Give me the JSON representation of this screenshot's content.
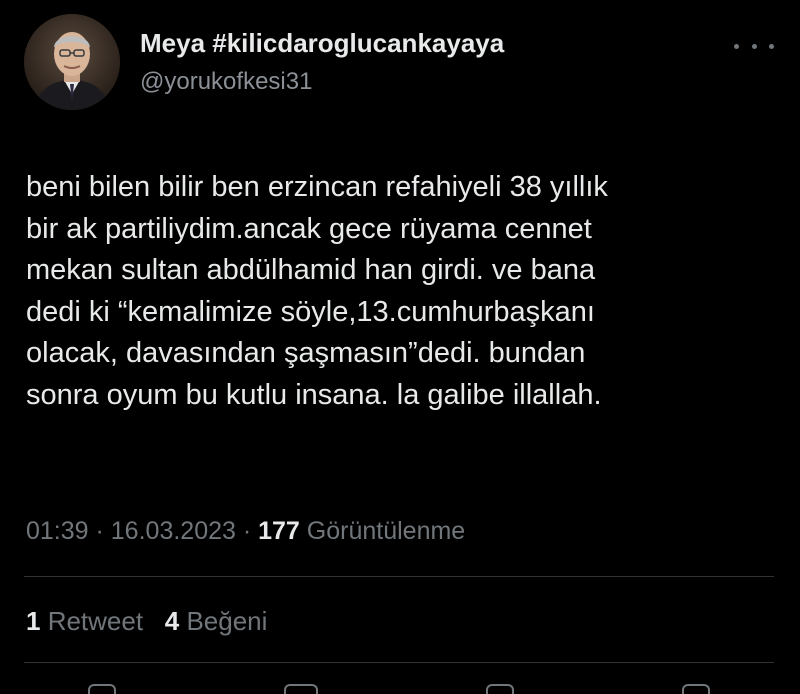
{
  "author": {
    "display_name": "Meya #kilicdaroglucankayaya",
    "handle": "@yorukofkesi31"
  },
  "icons": {
    "avatar": "profile-photo",
    "more": "more-horizontal-icon"
  },
  "tweet": {
    "text": "beni bilen bilir ben erzincan refahiyeli 38 yıllık\nbir ak partiliydim.ancak gece rüyama cennet\nmekan sultan abdülhamid han girdi. ve bana\ndedi ki “kemalimize söyle,13.cumhurbaşkanı\nolacak, davasından şaşmasın”dedi. bundan\nsonra oyum bu kutlu insana. la galibe illallah."
  },
  "meta": {
    "time": "01:39",
    "separator": " · ",
    "date": "16.03.2023",
    "views_count": "177",
    "views_label": " Görüntülenme"
  },
  "stats": {
    "retweets_count": "1",
    "retweets_label": " Retweet",
    "likes_count": "4",
    "likes_label": " Beğeni"
  },
  "colors": {
    "background": "#000000",
    "primary_text": "#e7e9ea",
    "secondary_text": "#71767b",
    "divider": "#2f3336"
  }
}
